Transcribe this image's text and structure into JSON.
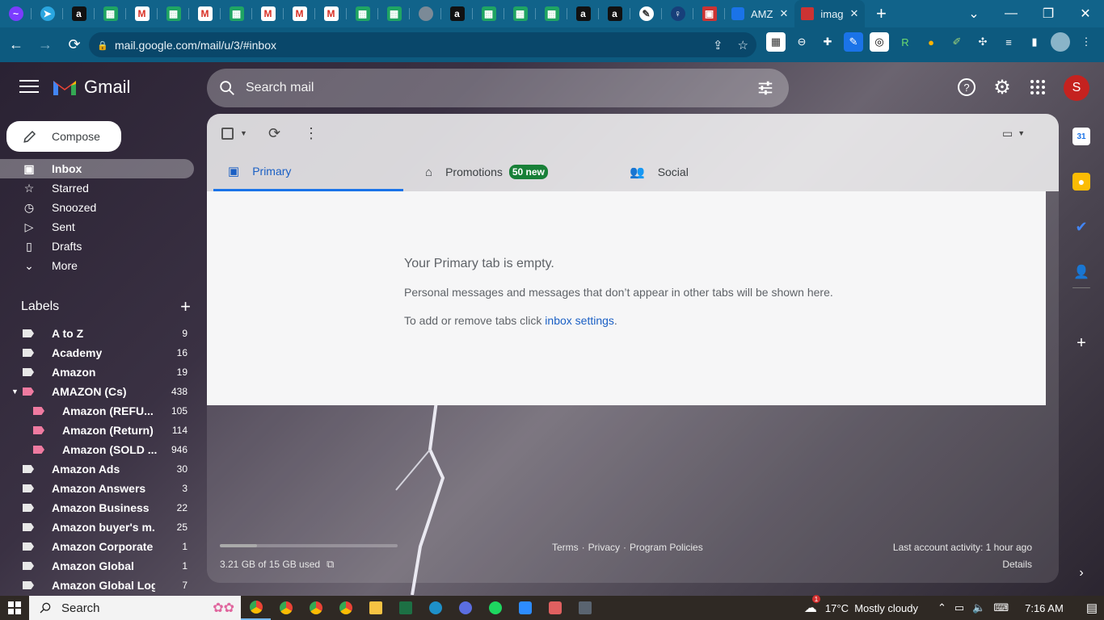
{
  "browser": {
    "tabs_favicons": [
      "messenger",
      "telegram",
      "amazon",
      "sheets",
      "gmail",
      "sheets",
      "gmail",
      "sheets",
      "gmail",
      "gmail",
      "gmail",
      "sheets",
      "sheets",
      "grey",
      "amazon",
      "sheets",
      "sheets",
      "sheets",
      "amazon",
      "amazon",
      "white",
      "dark",
      "red"
    ],
    "named_tabs": [
      {
        "label": "AMZ",
        "close": "✕"
      },
      {
        "label": "imag",
        "close": "✕"
      }
    ],
    "url": "mail.google.com/mail/u/3/#inbox"
  },
  "gmail": {
    "brand": "Gmail",
    "search_placeholder": "Search mail",
    "avatar_letter": "S",
    "compose_label": "Compose",
    "nav": [
      {
        "label": "Inbox",
        "icon": "inbox-icon",
        "active": true
      },
      {
        "label": "Starred",
        "icon": "star-icon"
      },
      {
        "label": "Snoozed",
        "icon": "clock-icon"
      },
      {
        "label": "Sent",
        "icon": "send-icon"
      },
      {
        "label": "Drafts",
        "icon": "draft-icon"
      },
      {
        "label": "More",
        "icon": "chevron-down-icon"
      }
    ],
    "labels_title": "Labels",
    "labels": [
      {
        "name": "A to Z",
        "count": "9"
      },
      {
        "name": "Academy",
        "count": "16"
      },
      {
        "name": "Amazon",
        "count": "19"
      },
      {
        "name": "AMAZON (Cs)",
        "count": "438",
        "expanded": true,
        "pink": true
      },
      {
        "name": "Amazon (REFU...",
        "count": "105",
        "child": true,
        "pink": true
      },
      {
        "name": "Amazon (Return)",
        "count": "114",
        "child": true,
        "pink": true
      },
      {
        "name": "Amazon (SOLD ...",
        "count": "946",
        "child": true,
        "pink": true
      },
      {
        "name": "Amazon Ads",
        "count": "30"
      },
      {
        "name": "Amazon Answers",
        "count": "3"
      },
      {
        "name": "Amazon Business",
        "count": "22"
      },
      {
        "name": "Amazon buyer's m...",
        "count": "25"
      },
      {
        "name": "Amazon Corporate",
        "count": "1"
      },
      {
        "name": "Amazon Global",
        "count": "1"
      },
      {
        "name": "Amazon Global Logi...",
        "count": "7"
      }
    ],
    "inbox_tabs": [
      {
        "label": "Primary",
        "icon": "inbox-icon",
        "selected": true
      },
      {
        "label": "Promotions",
        "icon": "tag-icon",
        "badge": "50 new"
      },
      {
        "label": "Social",
        "icon": "people-icon"
      }
    ],
    "empty": {
      "title": "Your Primary tab is empty.",
      "line1": "Personal messages and messages that don’t appear in other tabs will be shown here.",
      "line2_prefix": "To add or remove tabs click ",
      "line2_link": "inbox settings",
      "line2_suffix": "."
    },
    "footer": {
      "storage": "3.21 GB of 15 GB used",
      "storage_fraction": 0.21,
      "terms": "Terms",
      "privacy": "Privacy",
      "policies": "Program Policies",
      "sep": "·",
      "activity": "Last account activity: 1 hour ago",
      "details": "Details"
    }
  },
  "taskbar": {
    "search_label": "Search",
    "weather": "17°C  Mostly cloudy",
    "weather_badge": "1",
    "time": "7:16 AM"
  },
  "colors": {
    "chrome_tabbar": "#11638a",
    "chrome_toolbar": "#0d5a7f",
    "primary_blue": "#1a73e8",
    "badge_green": "#188038",
    "avatar_red": "#c5221f"
  }
}
